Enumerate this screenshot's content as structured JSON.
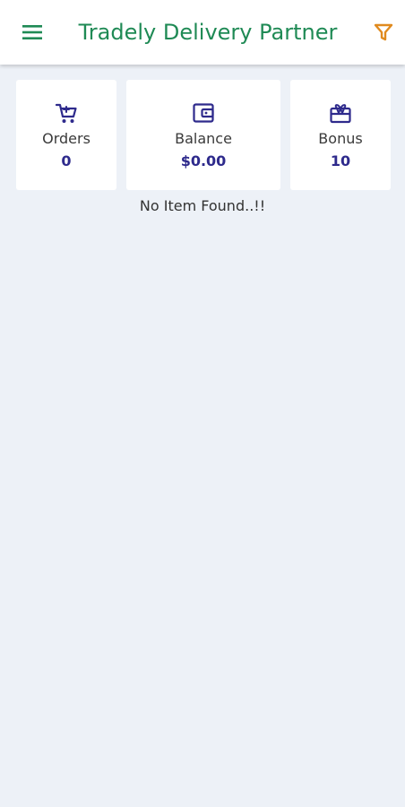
{
  "appbar": {
    "title": "Tradely Delivery Partner",
    "menu_icon": "menu-icon",
    "filter_icon": "filter-icon"
  },
  "stats": {
    "orders": {
      "label": "Orders",
      "value": "0",
      "icon": "cart-icon"
    },
    "balance": {
      "label": "Balance",
      "value": "$0.00",
      "icon": "wallet-icon"
    },
    "bonus": {
      "label": "Bonus",
      "value": "10",
      "icon": "gift-icon"
    }
  },
  "main": {
    "empty_message": "No Item Found..!!"
  },
  "colors": {
    "title": "#1f8a55",
    "filter_icon": "#e08a1e",
    "stat_icon": "#2e2a8c",
    "background": "#edf1f7"
  }
}
